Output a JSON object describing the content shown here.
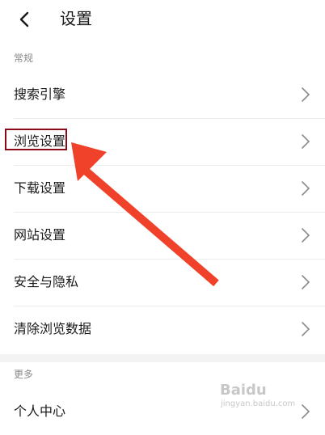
{
  "header": {
    "title": "设置",
    "back_icon": "chevron-left-icon"
  },
  "sections": {
    "general": {
      "label": "常规",
      "items": [
        {
          "label": "搜索引擎"
        },
        {
          "label": "浏览设置"
        },
        {
          "label": "下载设置"
        },
        {
          "label": "网站设置"
        },
        {
          "label": "安全与隐私"
        },
        {
          "label": "清除浏览数据"
        }
      ]
    },
    "more": {
      "label": "更多",
      "items": [
        {
          "label": "个人中心"
        }
      ]
    }
  },
  "annotation": {
    "highlighted_item": "浏览设置",
    "color": "#8b0a17",
    "arrow_color": "#f0412b"
  },
  "watermark": {
    "brand": "Baidu",
    "sub": "jingyan.baidu.com"
  }
}
